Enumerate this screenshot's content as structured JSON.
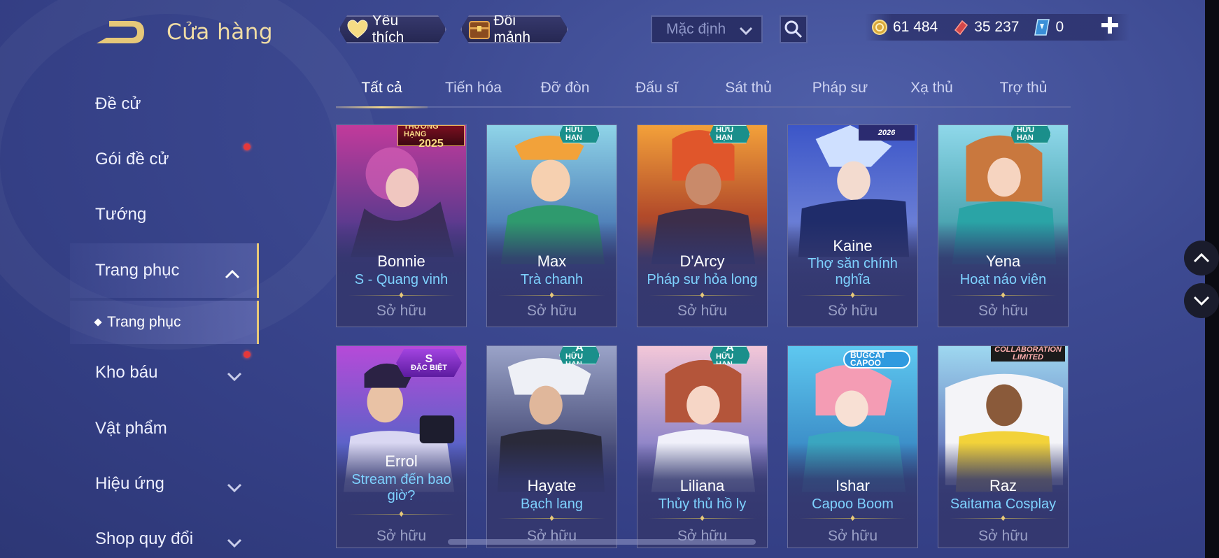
{
  "header": {
    "title": "Cửa hàng",
    "favorite_label": "Yêu thích",
    "shard_label": "Đổi mảnh",
    "sort_value": "Mặc định",
    "currencies": [
      {
        "icon": "gold-coin-icon",
        "value": "61 484"
      },
      {
        "icon": "voucher-icon",
        "value": "35 237"
      },
      {
        "icon": "diamond-ticket-icon",
        "value": "0"
      }
    ]
  },
  "sidebar": {
    "items": [
      {
        "label": "Đề cử"
      },
      {
        "label": "Gói đề cử"
      },
      {
        "label": "Tướng"
      },
      {
        "label": "Trang phục"
      },
      {
        "label": "Kho báu"
      },
      {
        "label": "Vật phẩm"
      },
      {
        "label": "Hiệu ứng"
      },
      {
        "label": "Shop quy đổi"
      }
    ],
    "sub_item": "Trang phục"
  },
  "tabs": [
    "Tất cả",
    "Tiến hóa",
    "Đỡ đòn",
    "Đấu sĩ",
    "Sát thủ",
    "Pháp sư",
    "Xạ thủ",
    "Trợ thủ"
  ],
  "active_tab": "Tất cả",
  "cards": [
    {
      "hero": "Bonnie",
      "skin": "S - Quang vinh",
      "status": "Sở hữu",
      "badge_top": "THƯỞNG HẠNG",
      "badge_bottom": "2025"
    },
    {
      "hero": "Max",
      "skin": "Trà chanh",
      "status": "Sở hữu",
      "badge": "HỮU HẠN"
    },
    {
      "hero": "D'Arcy",
      "skin": "Pháp sư hỏa long",
      "status": "Sở hữu",
      "badge": "HỮU HẠN"
    },
    {
      "hero": "Kaine",
      "skin": "Thợ săn chính nghĩa",
      "status": "Sở hữu",
      "badge": "2026"
    },
    {
      "hero": "Yena",
      "skin": "Hoạt náo viên",
      "status": "Sở hữu",
      "badge": "HỮU HẠN"
    },
    {
      "hero": "Errol",
      "skin": "Stream đến bao giờ?",
      "status": "Sở hữu",
      "badge_top": "S",
      "badge_bottom": "ĐẶC BIỆT"
    },
    {
      "hero": "Hayate",
      "skin": "Bạch lang",
      "status": "Sở hữu",
      "badge_top": "A",
      "badge_bottom": "HỮU HẠN"
    },
    {
      "hero": "Liliana",
      "skin": "Thủy thủ hồ ly",
      "status": "Sở hữu",
      "badge_top": "A",
      "badge_bottom": "HỮU HẠN"
    },
    {
      "hero": "Ishar",
      "skin": "Capoo Boom",
      "status": "Sở hữu",
      "badge": "BUGCAT CAPOO"
    },
    {
      "hero": "Raz",
      "skin": "Saitama Cosplay",
      "status": "Sở hữu",
      "badge_top": "COLLABORATION",
      "badge_bottom": "LIMITED"
    }
  ],
  "colors": {
    "accent_gold": "#e8c979",
    "skin_name": "#7ed2ff",
    "background": "#3d4a92",
    "notification": "#e5383b"
  }
}
